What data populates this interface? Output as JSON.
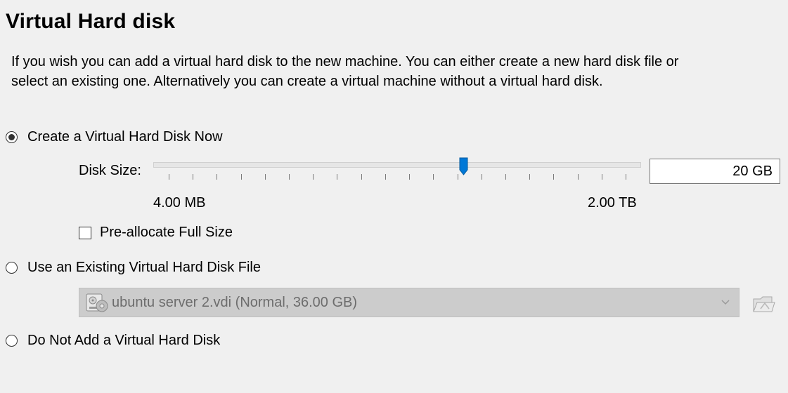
{
  "page": {
    "title": "Virtual Hard disk",
    "description": "If you wish you can add a virtual hard disk to the new machine. You can either create a new hard disk file or select an existing one. Alternatively you can create a virtual machine without a virtual hard disk."
  },
  "options": {
    "create_now": {
      "label": "Create a Virtual Hard Disk Now",
      "selected": true
    },
    "use_existing": {
      "label": "Use an Existing Virtual Hard Disk File",
      "selected": false
    },
    "no_disk": {
      "label": "Do Not Add a Virtual Hard Disk",
      "selected": false
    }
  },
  "disk_size": {
    "label": "Disk Size:",
    "value": "20 GB",
    "min_label": "4.00 MB",
    "max_label": "2.00 TB",
    "slider_fraction": 0.636,
    "tick_count": 20
  },
  "preallocate": {
    "label": "Pre-allocate Full Size",
    "checked": false
  },
  "existing_disk": {
    "selected_value": "ubuntu server 2.vdi (Normal, 36.00 GB)",
    "icon": "hard-disk-icon",
    "browse_icon": "folder-browse-icon"
  },
  "colors": {
    "accent": "#0078d7",
    "disabled_bg": "#cccccc",
    "disabled_text": "#6d6d6d",
    "window_bg": "#f0f0f0"
  }
}
